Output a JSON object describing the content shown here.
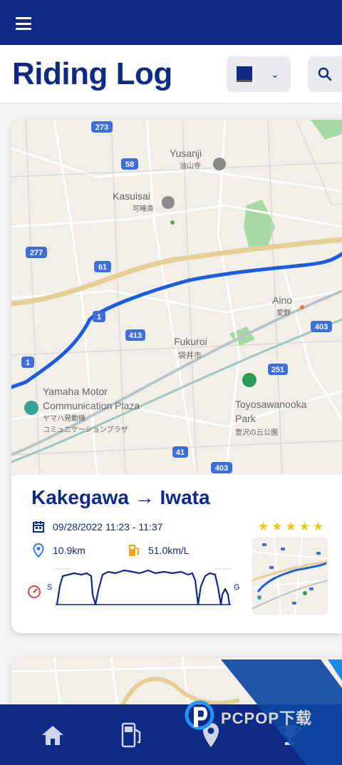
{
  "header": {
    "title": "Riding Log",
    "accent": "#0d2a86"
  },
  "map": {
    "road_numbers": [
      "273",
      "58",
      "277",
      "61",
      "1",
      "413",
      "1",
      "403",
      "251",
      "41",
      "403"
    ],
    "places": [
      {
        "name": "Yusanji",
        "sub": "油山寺"
      },
      {
        "name": "Kasuisai",
        "sub": "可睡斎"
      },
      {
        "name": "Aino",
        "sub": "愛野"
      },
      {
        "name": "Fukuroi",
        "sub": "袋井市"
      },
      {
        "name": "Yamaha Motor",
        "name2": "Communication Plaza",
        "sub": "ヤマハ発動機",
        "sub2": "コミュニケーションプラザ"
      },
      {
        "name": "Toyosawanooka",
        "name2": "Park",
        "sub": "豊沢の丘公園"
      }
    ],
    "route_color": "#1a5ce6"
  },
  "ride": {
    "route": "Kakegawa → Iwata",
    "datetime": "09/28/2022 11:23 - 11:37",
    "distance": "10.9km",
    "fuel": "51.0km/L",
    "graph_start": "S",
    "graph_end": "G",
    "rating": 5
  },
  "nav": {
    "items": [
      "home",
      "fuel",
      "location",
      "trophy"
    ]
  },
  "watermark": {
    "text": "PCPOP下载"
  }
}
